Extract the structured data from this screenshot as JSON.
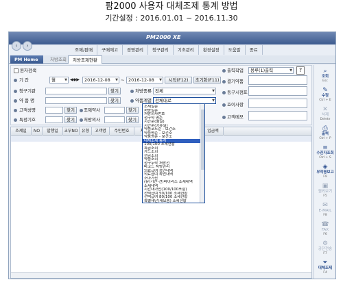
{
  "heading": {
    "title": "팜2000 사용자 대체조제 통계 방법",
    "subtitle": "기간설정 : 2016.01.01 ~ 2016.11.30"
  },
  "window": {
    "logo": "PM2000 XE",
    "menu": [
      "조제/판매",
      "구매재고",
      "경영관리",
      "청구관리",
      "기초관리",
      "환경설정",
      "도움말",
      "종료"
    ],
    "tabs": [
      "PM Home",
      "처방조회",
      "처방조제현황"
    ]
  },
  "form": {
    "raw_checkbox": "원자검색",
    "period_label": "기 간",
    "period_unit": "월",
    "date_from": "2016-12-08",
    "date_to": "2016-12-08",
    "start_button": "시작(F12)",
    "reset_button": "초기화(F11)",
    "hospital_label": "청구기관",
    "search_btn": "찾기",
    "pharmacist_label": "약 품 명",
    "patient_label": "고객성명",
    "doctor_label": "조제약사",
    "insurance_label": "특정기호",
    "prescriber_label": "처방의사",
    "type_label": "처방종류",
    "type_value": "전체",
    "category_label": "약품계열",
    "category_value": "전체대로",
    "output_label": "출력작업",
    "output_value": "용루(1)출력",
    "sub_label_1": "결기약품",
    "sub_label_2": "동구시점표",
    "sub_label_3": "효이사항",
    "sub_label_4": "고객메모",
    "help_glyph": "?"
  },
  "grid": {
    "columns": [
      "조제일",
      "NO",
      "발행일",
      "교부NO",
      "유형",
      "고객명",
      "주민번호",
      "처방약품",
      "청구액",
      "본인부담",
      "입금액"
    ]
  },
  "dropdown": {
    "options": [
      "조제일순",
      "처방일순",
      "처방의사번호",
      "청구약 명순",
      "시간순(월일)",
      "시간순(공휴일)",
      "약품코드순 - 보건소",
      "약품명순 - 보건소",
      "약품명순 - 보건소",
      "대체조제 통계",
      "100/100 조제현황",
      "특급조회",
      "카드조회",
      "현금조회",
      "약품조회",
      "청구누락 처방전",
      "바코드 처방관리",
      "의료급여 승인내역",
      "의료급여 확인내역",
      "소아가산",
      "(유)가산-전)바이러스 조제내역",
      "조제내역",
      "시간대가산(100/100포함)",
      "선택급여 50/100 조제현황",
      "선택급여 80/100 조제현황",
      "특별재난(재요용) 조제현황"
    ],
    "selected_index": 9
  },
  "sidebar": [
    {
      "icon": "magnifier-icon",
      "glyph": "⌕",
      "label": "조회",
      "key": "Esc",
      "active": true
    },
    {
      "icon": "pencil-icon",
      "glyph": "✎",
      "label": "수정",
      "key": "Ctrl + E",
      "active": true
    },
    {
      "icon": "trash-icon",
      "glyph": "✕",
      "label": "삭제",
      "key": "Delete",
      "active": false
    },
    {
      "icon": "printer-icon",
      "glyph": "⎙",
      "label": "출력",
      "key": "Ctrl + P",
      "active": true
    },
    {
      "icon": "receipt-icon",
      "glyph": "≡",
      "label": "수진자조회",
      "key": "Ctrl + S",
      "active": true
    },
    {
      "icon": "report-icon",
      "glyph": "◈",
      "label": "부작용보고",
      "key": "F9",
      "active": true
    },
    {
      "icon": "save-icon",
      "glyph": "▣",
      "label": "원외보기",
      "key": "F5",
      "active": false
    },
    {
      "icon": "mail-icon",
      "glyph": "✉",
      "label": "E-MAIL",
      "key": "F8",
      "active": false
    },
    {
      "icon": "fax-icon",
      "glyph": "☎",
      "label": "FAX",
      "key": "F6",
      "active": false
    },
    {
      "icon": "tool-icon",
      "glyph": "⚙",
      "label": "공단전송",
      "key": "F7",
      "active": false
    },
    {
      "icon": "filter-icon",
      "glyph": "⏷",
      "label": "대체조제",
      "key": "F4",
      "active": true
    }
  ]
}
